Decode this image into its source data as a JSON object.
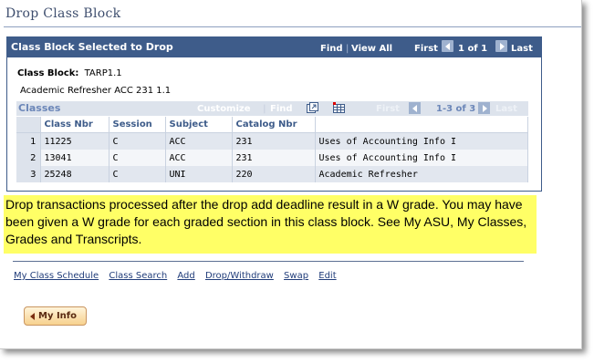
{
  "page": {
    "title": "Drop Class Block"
  },
  "panel": {
    "title": "Class Block Selected to Drop",
    "nav": {
      "find": "Find",
      "view_all": "View All",
      "first": "First",
      "range": "1 of 1",
      "last": "Last"
    },
    "class_block_label": "Class Block:",
    "class_block_value": "TARP1.1",
    "class_block_desc": "Academic Refresher ACC 231 1.1"
  },
  "grid": {
    "title": "Classes",
    "customize": "Customize",
    "find": "Find",
    "first": "First",
    "range": "1-3 of 3",
    "last": "Last",
    "columns": [
      "Class Nbr",
      "Session",
      "Subject",
      "Catalog Nbr",
      ""
    ],
    "rows": [
      {
        "num": "1",
        "class_nbr": "11225",
        "session": "C",
        "subject": "ACC",
        "catalog": "231",
        "desc": "Uses of Accounting Info I"
      },
      {
        "num": "2",
        "class_nbr": "13041",
        "session": "C",
        "subject": "ACC",
        "catalog": "231",
        "desc": "Uses of Accounting Info I"
      },
      {
        "num": "3",
        "class_nbr": "25248",
        "session": "C",
        "subject": "UNI",
        "catalog": "220",
        "desc": "Academic Refresher"
      }
    ]
  },
  "notice": "Drop transactions processed after the drop add deadline result in a W grade. You may have been given a W grade for each graded section in this class block. See My ASU, My Classes, Grades and Transcripts.",
  "links": [
    "My Class Schedule",
    "Class Search",
    "Add",
    "Drop/Withdraw",
    "Swap",
    "Edit"
  ],
  "myinfo_button": "My Info",
  "colors": {
    "header_blue": "#3e5c8a",
    "notice_yellow": "#ffff66",
    "button_orange": "#f7d18e"
  }
}
